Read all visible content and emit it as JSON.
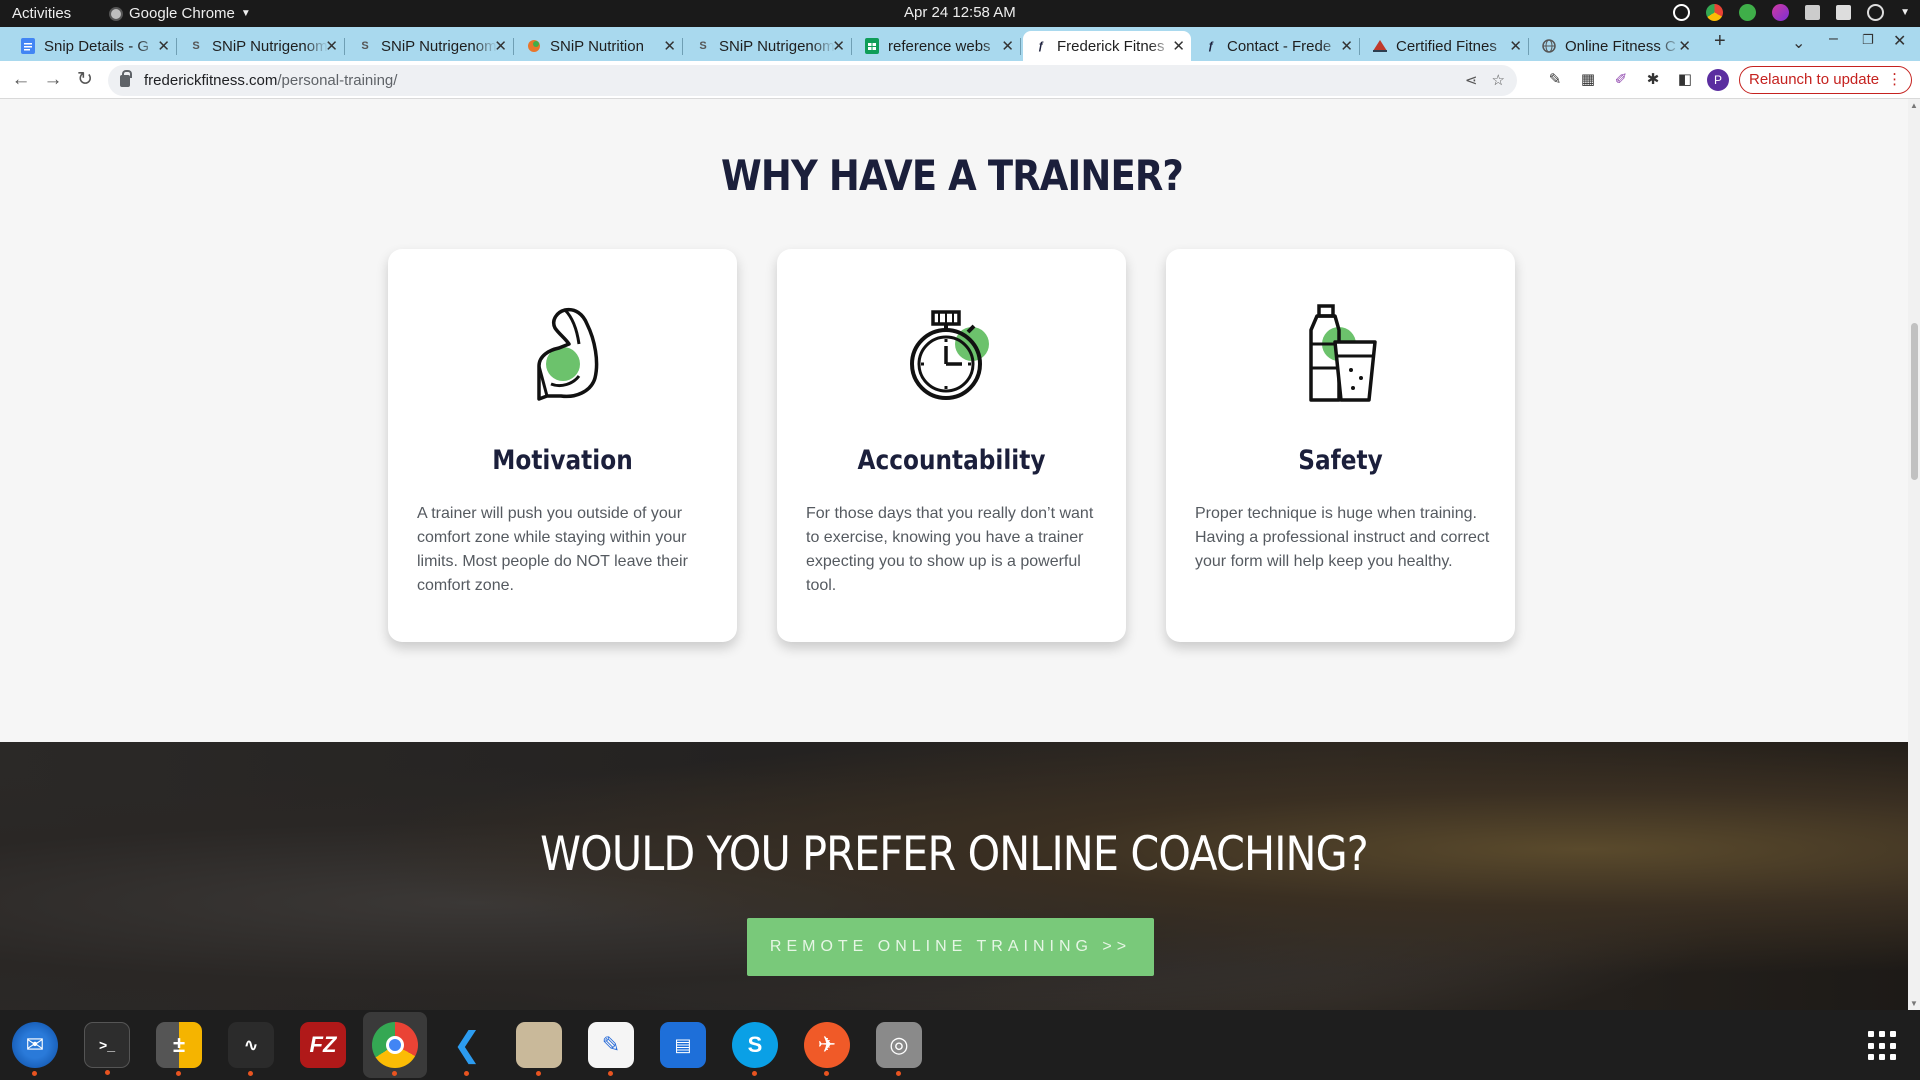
{
  "system": {
    "activities": "Activities",
    "app_name": "Google Chrome",
    "clock": "Apr 24  12:58 AM"
  },
  "browser": {
    "tabs": [
      {
        "title": "Snip Details - G",
        "icon": "docs-icon",
        "active": false
      },
      {
        "title": "SNiP Nutrigenom",
        "icon": "snip-icon",
        "active": false
      },
      {
        "title": "SNiP Nutrigenom",
        "icon": "snip-icon",
        "active": false
      },
      {
        "title": "SNiP Nutrition",
        "icon": "nutrition-icon",
        "active": false
      },
      {
        "title": "SNiP Nutrigenom",
        "icon": "snip-icon",
        "active": false
      },
      {
        "title": "reference webs",
        "icon": "sheets-icon",
        "active": false
      },
      {
        "title": "Frederick Fitnes",
        "icon": "frederick-icon",
        "active": true
      },
      {
        "title": "Contact - Frede",
        "icon": "frederick-icon",
        "active": false
      },
      {
        "title": "Certified Fitnes",
        "icon": "certified-icon",
        "active": false
      },
      {
        "title": "Online Fitness C",
        "icon": "globe-icon",
        "active": false
      }
    ],
    "url_domain": "frederickfitness.com",
    "url_path": "/personal-training/",
    "relaunch_label": "Relaunch to update",
    "profile_initial": "P"
  },
  "page": {
    "why_heading": "WHY HAVE A TRAINER?",
    "cards": [
      {
        "title": "Motivation",
        "icon": "flexed-arm-icon",
        "text": "A trainer will push you outside of your comfort zone while staying within your limits. Most people do NOT leave their comfort zone."
      },
      {
        "title": "Accountability",
        "icon": "stopwatch-icon",
        "text": "For those days that you really don’t want to exercise, knowing you have a trainer expecting you to show up is a powerful tool."
      },
      {
        "title": "Safety",
        "icon": "water-bottle-glass-icon",
        "text": "Proper technique is huge when training. Having a professional instruct and correct your form will help keep you healthy."
      }
    ],
    "coaching_heading": "WOULD YOU PREFER ONLINE COACHING?",
    "coaching_cta": "REMOTE ONLINE TRAINING >>"
  },
  "colors": {
    "heading": "#1b1f3b",
    "accent_green": "#79c97a",
    "icon_green": "#6cc26c",
    "tabstrip": "#a9d9ee",
    "relaunch": "#c5221f"
  },
  "dock": [
    "thunderbird-icon",
    "terminal-icon",
    "calculator-icon",
    "system-monitor-icon",
    "filezilla-icon",
    "chrome-icon",
    "vscode-icon",
    "files-icon",
    "text-editor-icon",
    "libreoffice-writer-icon",
    "skype-icon",
    "postman-icon",
    "disks-icon"
  ]
}
